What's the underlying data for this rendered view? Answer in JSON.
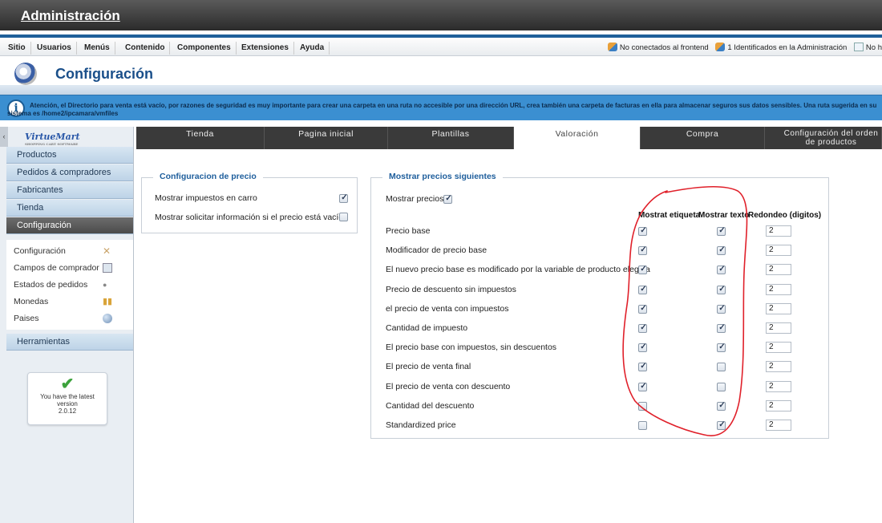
{
  "app": {
    "admin_title": "Administración"
  },
  "menu": {
    "items": [
      "Sitio",
      "Usuarios",
      "Menús",
      "Contenido",
      "Componentes",
      "Extensiones",
      "Ayuda"
    ],
    "status_frontend": "No conectados al frontend",
    "status_admin": "1 Identificados en la Administración",
    "status_more": "No h"
  },
  "header": {
    "title": "Configuración"
  },
  "warning": {
    "text": "Atención, el Directorio para venta está vacío, por razones de seguridad es muy importante para crear una carpeta en una ruta no accesible por una dirección URL, crea también una carpeta de facturas en ella para almacenar seguros sus datos sensibles. Una ruta sugerida en su sistema es /home2/ipcamara/vmfiles"
  },
  "sidebar": {
    "logo": "VirtueMart",
    "logo_sub": "SHOPPING CART SOFTWARE",
    "categories": [
      "Productos",
      "Pedidos & compradores",
      "Fabricantes",
      "Tienda",
      "Configuración"
    ],
    "subitems": [
      "Configuración",
      "Campos de comprador",
      "Estados de pedidos",
      "Monedas",
      "Paises"
    ],
    "tools": "Herramientas",
    "version_line1": "You have the latest",
    "version_line2": "version",
    "version_number": "2.0.12"
  },
  "tabs": [
    {
      "label": "Tienda",
      "active": false
    },
    {
      "label": "Pagina inicial",
      "active": false
    },
    {
      "label": "Plantillas",
      "active": false
    },
    {
      "label": "Valoración",
      "active": true
    },
    {
      "label": "Compra",
      "active": false
    },
    {
      "label": "Configuración del orden de productos",
      "active": false
    }
  ],
  "price_config": {
    "legend": "Configuracion de precio",
    "show_tax_in_cart": {
      "label": "Mostrar impuestos en carro",
      "checked": true
    },
    "ask_price_info": {
      "label": "Mostrar solicitar información si el precio está vacío",
      "checked": false
    }
  },
  "show_prices": {
    "legend": "Mostrar precios siguientes",
    "show_prices": {
      "label": "Mostrar precios",
      "checked": true
    },
    "col_label": "Mostrat etiqueta",
    "col_text": "Mostrar texto",
    "col_round": "Redondeo (digitos)",
    "rows": [
      {
        "label": "Precio base",
        "show_label": true,
        "show_text": true,
        "rounding": "2"
      },
      {
        "label": "Modificador de precio base",
        "show_label": true,
        "show_text": true,
        "rounding": "2"
      },
      {
        "label": "El nuevo precio base es modificado por la variable de producto elegida",
        "show_label": true,
        "show_text": true,
        "rounding": "2"
      },
      {
        "label": "Precio de descuento sin impuestos",
        "show_label": true,
        "show_text": true,
        "rounding": "2"
      },
      {
        "label": "el precio de venta con impuestos",
        "show_label": true,
        "show_text": true,
        "rounding": "2"
      },
      {
        "label": "Cantidad de impuesto",
        "show_label": true,
        "show_text": true,
        "rounding": "2"
      },
      {
        "label": "El precio base con impuestos, sin descuentos",
        "show_label": true,
        "show_text": true,
        "rounding": "2"
      },
      {
        "label": "El precio de venta final",
        "show_label": true,
        "show_text": false,
        "rounding": "2"
      },
      {
        "label": "El precio de venta con descuento",
        "show_label": true,
        "show_text": false,
        "rounding": "2"
      },
      {
        "label": "Cantidad del descuento",
        "show_label": false,
        "show_text": true,
        "rounding": "2"
      },
      {
        "label": "Standardized price",
        "show_label": false,
        "show_text": true,
        "rounding": "2"
      }
    ]
  },
  "colors": {
    "accent": "#1e5e9c",
    "annotation": "#e0202a",
    "active_cat": "#555555"
  }
}
